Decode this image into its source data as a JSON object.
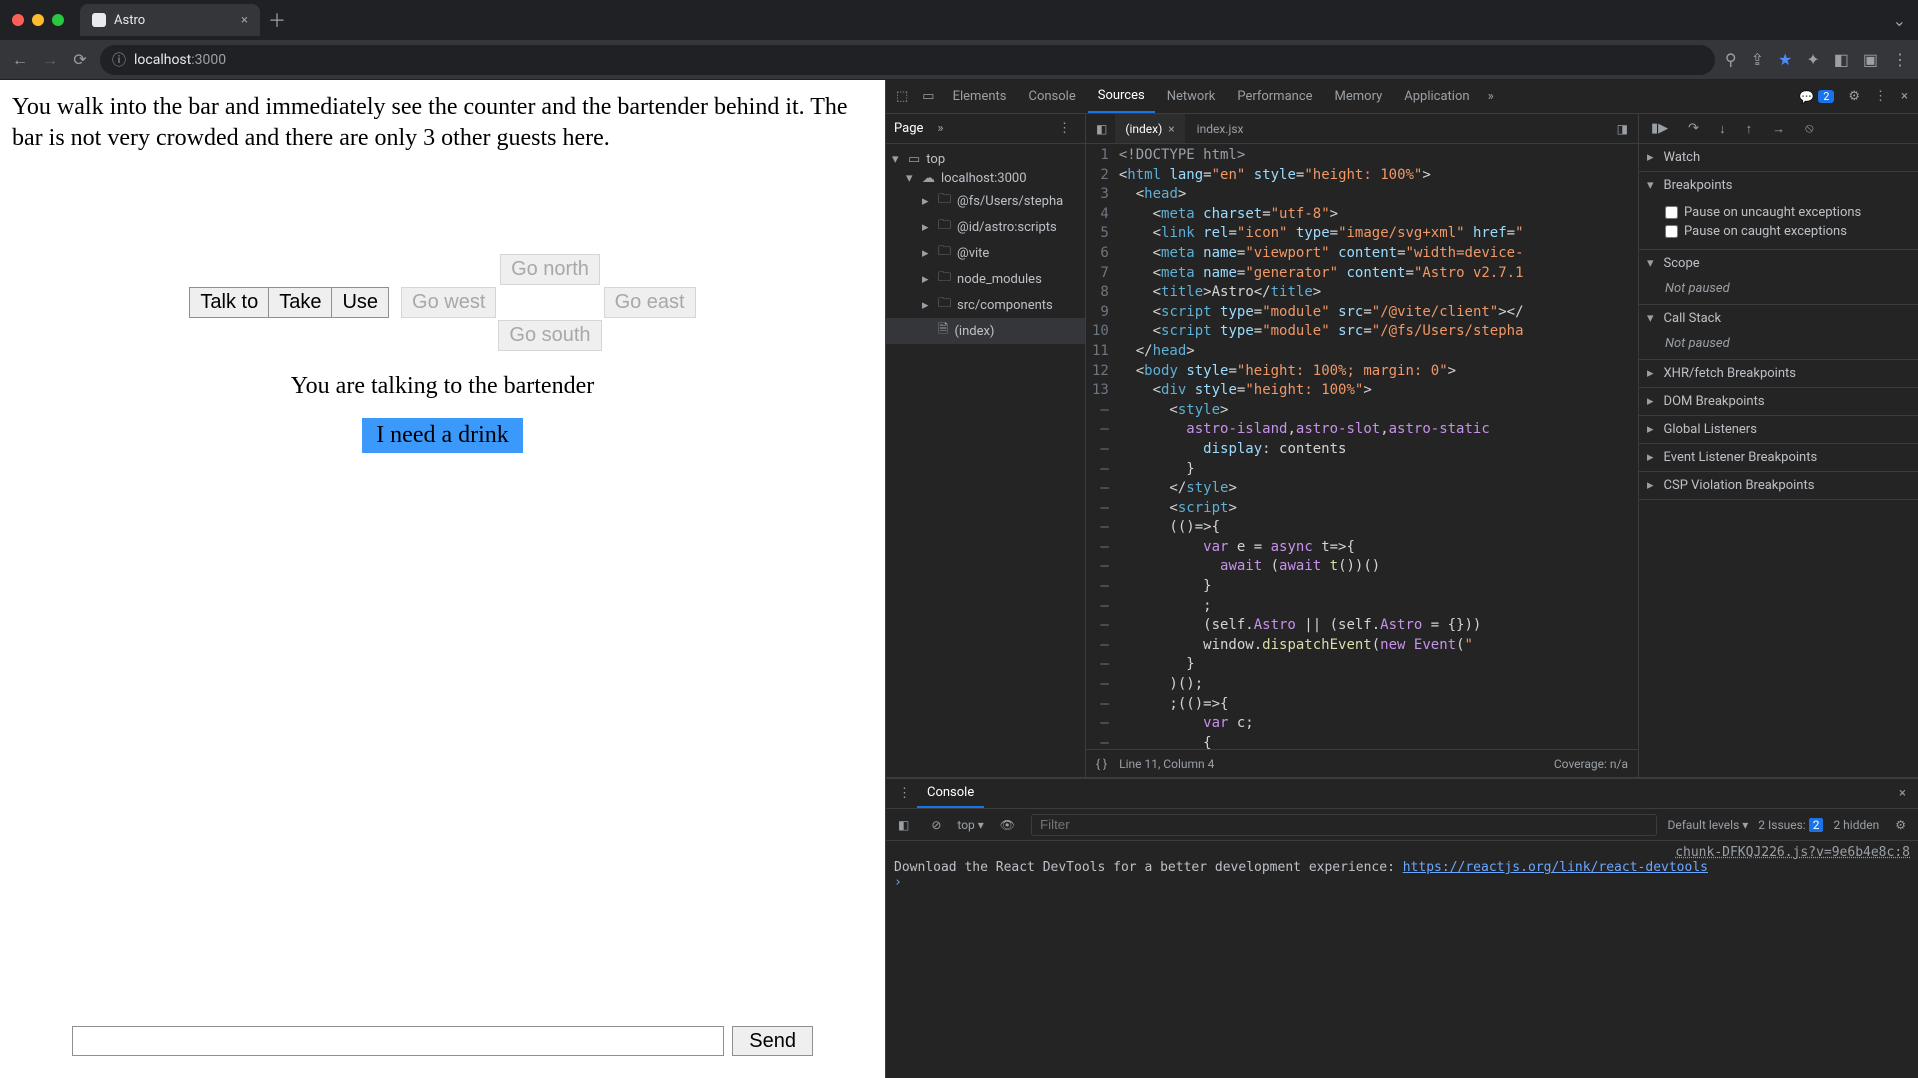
{
  "browser": {
    "tab_title": "Astro",
    "url_host": "localhost",
    "url_port": ":3000"
  },
  "page": {
    "narration": "You walk into the bar and immediately see the counter and the bartender behind it. The bar is not very crowded and there are only 3 other guests here.",
    "verbs": {
      "talk": "Talk to",
      "take": "Take",
      "use": "Use"
    },
    "dirs": {
      "north": "Go north",
      "west": "Go west",
      "east": "Go east",
      "south": "Go south"
    },
    "status": "You are talking to the bartender",
    "option1": "I need a drink",
    "send": "Send"
  },
  "devtools": {
    "tabs": [
      "Elements",
      "Console",
      "Sources",
      "Network",
      "Performance",
      "Memory",
      "Application"
    ],
    "issues_count": "2",
    "nav": {
      "page_tab": "Page",
      "top": "top",
      "host": "localhost:3000",
      "folders": [
        "@fs/Users/stepha",
        "@id/astro:scripts",
        "@vite",
        "node_modules",
        "src/components"
      ],
      "file": "(index)"
    },
    "editor": {
      "tabs": {
        "active": "(index)",
        "other": "index.jsx"
      },
      "status_line": "Line 11, Column 4",
      "coverage": "Coverage: n/a",
      "gutter": "1\n2\n3\n4\n5\n6\n7\n8\n9\n10\n11\n12\n13\n—\n—\n—\n—\n—\n—\n—\n—\n—\n—\n—\n—\n—\n—\n—\n—\n—\n—\n—"
    },
    "right": {
      "watch": "Watch",
      "breakpoints": "Breakpoints",
      "bp_uncaught": "Pause on uncaught exceptions",
      "bp_caught": "Pause on caught exceptions",
      "scope": "Scope",
      "not_paused": "Not paused",
      "callstack": "Call Stack",
      "xhr": "XHR/fetch Breakpoints",
      "dom": "DOM Breakpoints",
      "global": "Global Listeners",
      "evt": "Event Listener Breakpoints",
      "csp": "CSP Violation Breakpoints"
    },
    "console": {
      "tab": "Console",
      "context": "top",
      "filter_ph": "Filter",
      "levels": "Default levels",
      "issues_label": "2 Issues:",
      "issues_chip": "2",
      "hidden": "2 hidden",
      "src_hint": "chunk-DFKQJ226.js?v=9e6b4e8c:8",
      "msg": "Download the React DevTools for a better development experience: ",
      "link": "https://reactjs.org/link/react-devtools"
    }
  }
}
